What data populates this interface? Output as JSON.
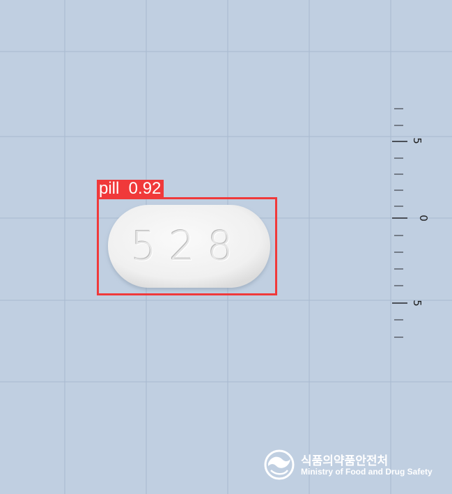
{
  "detection": {
    "label": "pill  0.92"
  },
  "pill": {
    "imprint": "528",
    "color": "#f2f2f2"
  },
  "ruler": {
    "labels": [
      "5",
      "0",
      "5"
    ]
  },
  "watermark": {
    "korean": "식품의약품안전처",
    "english": "Ministry of Food and Drug Safety"
  },
  "colors": {
    "background": "#c0cfe1",
    "grid_line": "#a9bbd1",
    "bbox": "#f0393a"
  }
}
